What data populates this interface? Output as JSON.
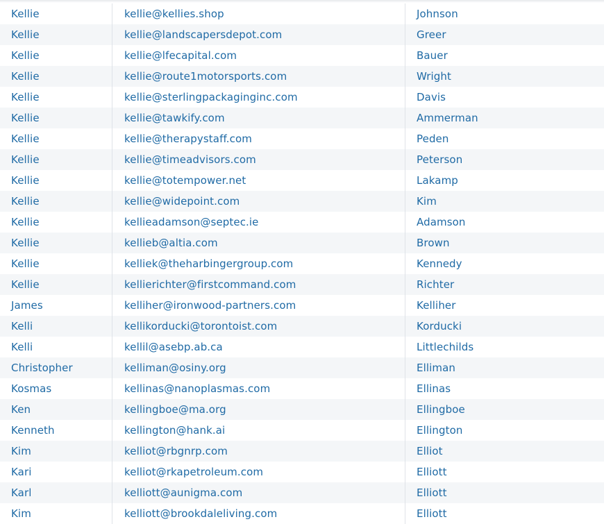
{
  "table": {
    "rows": [
      {
        "first": "Kellie",
        "email": "kellie@kellies.shop",
        "last": "Johnson"
      },
      {
        "first": "Kellie",
        "email": "kellie@landscapersdepot.com",
        "last": "Greer"
      },
      {
        "first": "Kellie",
        "email": "kellie@lfecapital.com",
        "last": "Bauer"
      },
      {
        "first": "Kellie",
        "email": "kellie@route1motorsports.com",
        "last": "Wright"
      },
      {
        "first": "Kellie",
        "email": "kellie@sterlingpackaginginc.com",
        "last": "Davis"
      },
      {
        "first": "Kellie",
        "email": "kellie@tawkify.com",
        "last": "Ammerman"
      },
      {
        "first": "Kellie",
        "email": "kellie@therapystaff.com",
        "last": "Peden"
      },
      {
        "first": "Kellie",
        "email": "kellie@timeadvisors.com",
        "last": "Peterson"
      },
      {
        "first": "Kellie",
        "email": "kellie@totempower.net",
        "last": "Lakamp"
      },
      {
        "first": "Kellie",
        "email": "kellie@widepoint.com",
        "last": "Kim"
      },
      {
        "first": "Kellie",
        "email": "kellieadamson@septec.ie",
        "last": "Adamson"
      },
      {
        "first": "Kellie",
        "email": "kellieb@altia.com",
        "last": "Brown"
      },
      {
        "first": "Kellie",
        "email": "kelliek@theharbingergroup.com",
        "last": "Kennedy"
      },
      {
        "first": "Kellie",
        "email": "kellierichter@firstcommand.com",
        "last": "Richter"
      },
      {
        "first": "James",
        "email": "kelliher@ironwood-partners.com",
        "last": "Kelliher"
      },
      {
        "first": "Kelli",
        "email": "kellikorducki@torontoist.com",
        "last": "Korducki"
      },
      {
        "first": "Kelli",
        "email": "kellil@asebp.ab.ca",
        "last": "Littlechilds"
      },
      {
        "first": "Christopher",
        "email": "kelliman@osiny.org",
        "last": "Elliman"
      },
      {
        "first": "Kosmas",
        "email": "kellinas@nanoplasmas.com",
        "last": "Ellinas"
      },
      {
        "first": "Ken",
        "email": "kellingboe@ma.org",
        "last": "Ellingboe"
      },
      {
        "first": "Kenneth",
        "email": "kellington@hank.ai",
        "last": "Ellington"
      },
      {
        "first": "Kim",
        "email": "kelliot@rbgnrp.com",
        "last": "Elliot"
      },
      {
        "first": "Kari",
        "email": "kelliot@rkapetroleum.com",
        "last": "Elliott"
      },
      {
        "first": "Karl",
        "email": "kelliott@aunigma.com",
        "last": "Elliott"
      },
      {
        "first": "Kim",
        "email": "kelliott@brookdaleliving.com",
        "last": "Elliott"
      }
    ]
  }
}
